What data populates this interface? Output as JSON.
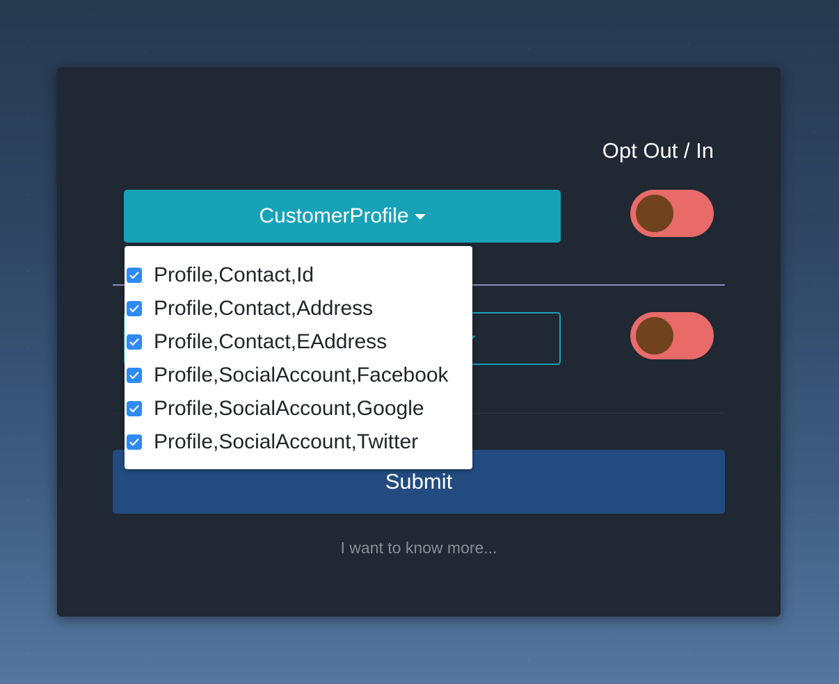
{
  "colors": {
    "card_bg": "#1f2833",
    "teal": "#17a2b8",
    "toggle_track": "#e96b69",
    "toggle_knob": "#70421e",
    "submit_bg": "#234b80",
    "checkbox": "#2e8af5"
  },
  "form": {
    "opt_heading": "Opt Out / In",
    "dropdowns": [
      {
        "label": "CustomerProfile",
        "expanded": true
      },
      {
        "label": "",
        "expanded": false
      }
    ],
    "toggles": [
      {
        "state": "off"
      },
      {
        "state": "off"
      }
    ],
    "submit_label": "Submit",
    "more_link": "I want to know more..."
  },
  "menu": {
    "items": [
      {
        "label": "Profile,Contact,Id",
        "checked": true
      },
      {
        "label": "Profile,Contact,Address",
        "checked": true
      },
      {
        "label": "Profile,Contact,EAddress",
        "checked": true
      },
      {
        "label": "Profile,SocialAccount,Facebook",
        "checked": true
      },
      {
        "label": "Profile,SocialAccount,Google",
        "checked": true
      },
      {
        "label": "Profile,SocialAccount,Twitter",
        "checked": true
      }
    ]
  }
}
